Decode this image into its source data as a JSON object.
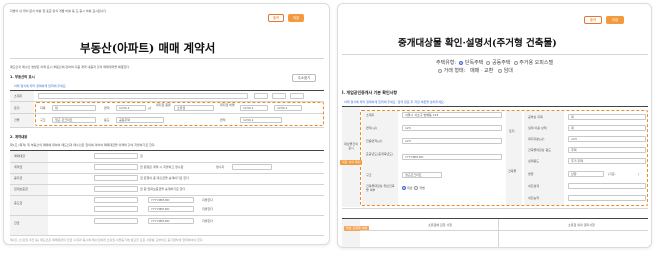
{
  "left": {
    "breadcrumb": "지방이 내 위치 문서 바를 형 표준 양식 개발 바를 등 도 중시 바를 표시됩니다",
    "print_label": "출력",
    "save_label": "저장",
    "title": "부동산(아파트) 매매 계약서",
    "intro_note": "매도인과 매수인 쌍방은 아래 표시 부동산에 관하여 다음 계약 내용과 같이 매매계약을 체결한다.",
    "section1_title": "1. 부동산의 표시",
    "section1_action": "주소찾기",
    "section1_hint": "아래 형식에 따라 정확하게 입력해 주세요.",
    "row_labels": [
      "소재지",
      "토지",
      "건물"
    ],
    "field_labels": {
      "jimok": "지목",
      "area": "면적",
      "share_type": "대지권 종류",
      "share_ratio": "대지권 비율",
      "structure": "구조",
      "use": "용도",
      "building_area": "면적"
    },
    "field_values": {
      "jimok": "대",
      "area": "1234.1",
      "share_type": "소유권",
      "share_ratio": "1234.1",
      "structure": "철근 콘크리트",
      "use": "공동주택",
      "building_area": "1234.1"
    },
    "unit_m2": "㎡",
    "section2_title": "2. 계약내용",
    "section2_sub": "제1조 (목적) 위 부동산의 매매에 대하여 매도인과 매수인은 합의에 의하여 매매대금을 아래와 같이 지불하기로 한다.",
    "money_labels": [
      "매매대금",
      "계약금",
      "융자금",
      "임대보증금",
      "중도금",
      "잔금"
    ],
    "money_lines": [
      "금",
      "금  원정은 계약 시 지불하고 영수함",
      "금  은행의 총 대출금을 승계하기로 한다",
      "금  원 임대보증금을 승계하기로 한다",
      "금  원정은  에 지불하며",
      "금  원정은  에 지불한다"
    ],
    "receipt_label": "영수자",
    "date_placeholder": "YYYY.MM.DD",
    "pay_label": "지불한다",
    "footer_note": "제2조 (소유권 이전 등) 매도인은 매매대금의 잔금 수령과 동시에 매수인에게 소유권 이전등기에 필요한 모든 서류를 교부하고 등기절차에 협력하여야 한다."
  },
  "right": {
    "print_label": "출력",
    "save_label": "저장",
    "title": "중개대상물 확인·설명서(주거형 건축물)",
    "type_label": "주택유형:",
    "type_options": [
      {
        "label": "단독주택",
        "selected": true
      },
      {
        "label": "공동주택",
        "selected": false
      },
      {
        "label": "주거용 오피스텔",
        "selected": false
      }
    ],
    "deal_label": "거래 형태:",
    "deal_options": [
      "매매 · 교환",
      "임대"
    ],
    "section_title": "I. 개업공인중개사 기본 확인사항",
    "hint": "아래 형식에 따라 정확하게 입력해 주세요. 입력 완료 후 저장 버튼을 눌러주세요.",
    "group_label": "대상물건의 표시",
    "badge": "대장 상의 확인",
    "left_labels": [
      "소재지",
      "면적(㎡)",
      "전용면적(㎡)",
      "준공년도(증개축년도)",
      "구조",
      "건축물대장상 위반건축물 여부"
    ],
    "left_values": [
      "서울시 서초구 방배동 123",
      "123",
      "123",
      "YYYY.MM.DD",
      "철근콘크리트",
      "위반",
      "적법"
    ],
    "right_group_labels": [
      "토지",
      "건축물"
    ],
    "right_labels": [
      "공부상 지목",
      "실제 이용 상태",
      "대지지분(㎡)",
      "건축물대장상 용도",
      "실제용도",
      "방향",
      "내진설계",
      "내진능력"
    ],
    "right_values": [
      "대",
      "대",
      "123",
      "주택",
      "주거 주택",
      "남향",
      "(기준:",
      ")"
    ],
    "bottom_labels": [
      "소유권에 관한 사항",
      "소유권 외의 권리사항"
    ],
    "side_badge": "위반 건축물 여부"
  }
}
